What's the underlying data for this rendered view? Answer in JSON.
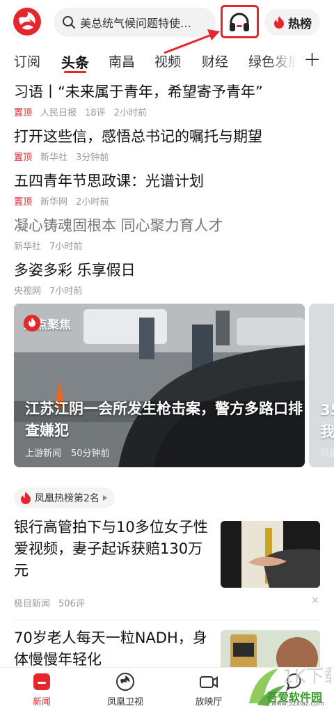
{
  "header": {
    "search_placeholder": "美总统气候问题特使…",
    "hot_label": "热榜"
  },
  "tabs": [
    "订阅",
    "头条",
    "南昌",
    "视频",
    "财经",
    "绿色发展"
  ],
  "news": [
    {
      "title": "习语丨“未来属于青年，希望寄予青年”",
      "tag": "置顶",
      "source": "人民日报",
      "comments": "18评",
      "time": "2小时前"
    },
    {
      "title": "打开这些信，感悟总书记的嘱托与期望",
      "tag": "置顶",
      "source": "新华社",
      "time": "3分钟前"
    },
    {
      "title": "五四青年节思政课：光谱计划",
      "tag": "置顶",
      "source": "新华网",
      "time": "2小时前"
    },
    {
      "title": "凝心铸魂固根本 同心聚力育人才",
      "source": "新华社",
      "time": "7小时前"
    },
    {
      "title": "多姿多彩 乐享假日",
      "source": "央视网",
      "time": "7小时前"
    }
  ],
  "hot_card": {
    "badge": "热点聚焦",
    "title": "江苏江阴一会所发生枪击案，警方多路口排查嫌犯",
    "source": "上游新闻",
    "time": "50分钟前",
    "next_title_fragment": "35\n我",
    "next_source_fragment": "凤凰"
  },
  "rank_chip": "凤凰热榜第2名",
  "image_news": [
    {
      "title": "银行高管拍下与10多位女子性爱视频，妻子起诉获赔130万元",
      "source": "极目新闻",
      "comments": "506评"
    },
    {
      "title": "70岁老人每天一粒NADH，身体慢慢年轻化"
    }
  ],
  "bottom_nav": [
    {
      "label": "新闻",
      "icon": "news-icon"
    },
    {
      "label": "凤凰卫视",
      "icon": "phoenix-tv-icon"
    },
    {
      "label": "放映厅",
      "icon": "video-camera-icon"
    },
    {
      "label": "",
      "icon": "chat-icon"
    }
  ],
  "watermark": {
    "text": "吾爱软件园",
    "url": "www.52xiaz.com"
  },
  "colors": {
    "accent": "#e5262d"
  }
}
